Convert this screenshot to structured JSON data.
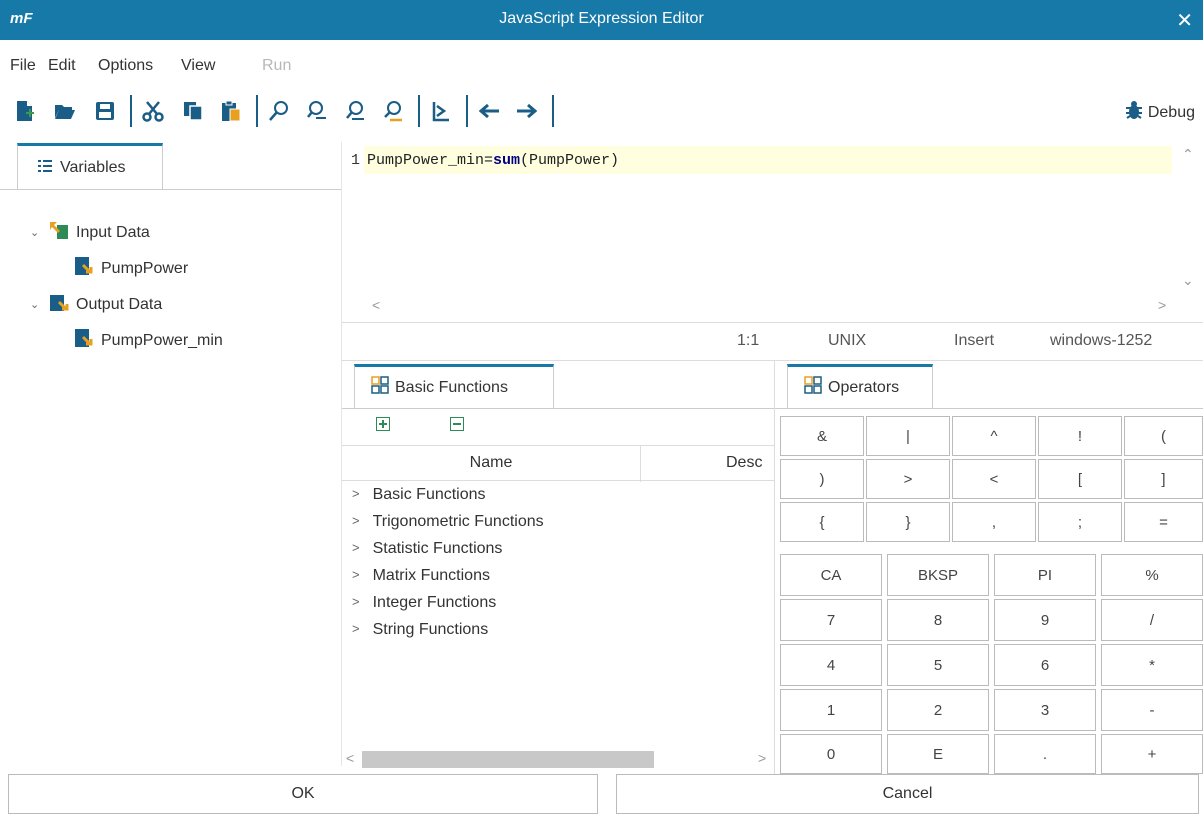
{
  "window": {
    "logo": "mF",
    "title": "JavaScript Expression Editor",
    "close_glyph": "✕"
  },
  "menu": [
    "File",
    "Edit",
    "Options",
    "View",
    "Run"
  ],
  "toolbar": {
    "debug_label": "Debug",
    "icons": [
      "new-file-icon",
      "open-folder-icon",
      "save-icon",
      "cut-icon",
      "copy-icon",
      "paste-icon",
      "find-icon",
      "find-next-icon",
      "find-previous-icon",
      "replace-icon",
      "goto-line-icon",
      "back-arrow-icon",
      "forward-arrow-icon"
    ]
  },
  "variables": {
    "tab_label": "Variables",
    "input_group": "Input Data",
    "input_item": "PumpPower",
    "output_group": "Output Data",
    "output_item": "PumpPower_min"
  },
  "editor": {
    "line_number": "1",
    "code_prefix": "PumpPower_min=",
    "code_keyword": "sum",
    "code_suffix": "(PumpPower)"
  },
  "status": {
    "position": "1:1",
    "line_endings": "UNIX",
    "mode": "Insert",
    "encoding": "windows-1252"
  },
  "functions": {
    "tab_label": "Basic Functions",
    "col_name": "Name",
    "col_desc": "Desc",
    "items": [
      "Basic Functions",
      "Trigonometric Functions",
      "Statistic Functions",
      "Matrix Functions",
      "Integer Functions",
      "String Functions"
    ]
  },
  "operators": {
    "tab_label": "Operators",
    "row1": [
      "&",
      "|",
      "^",
      "!",
      "("
    ],
    "row2": [
      ")",
      ">",
      "<",
      "[",
      "]"
    ],
    "row3": [
      "{",
      "}",
      ",",
      ";",
      "="
    ],
    "keypad": [
      [
        "CA",
        "BKSP",
        "PI",
        "%"
      ],
      [
        "7",
        "8",
        "9",
        "/"
      ],
      [
        "4",
        "5",
        "6",
        "*"
      ],
      [
        "1",
        "2",
        "3",
        "-"
      ],
      [
        "0",
        "E",
        ".",
        "+"
      ]
    ]
  },
  "footer": {
    "ok": "OK",
    "cancel": "Cancel"
  },
  "colors": {
    "titlebar": "#1679a7",
    "accent": "#1679a7",
    "code_line_highlight": "#ffffe0"
  }
}
